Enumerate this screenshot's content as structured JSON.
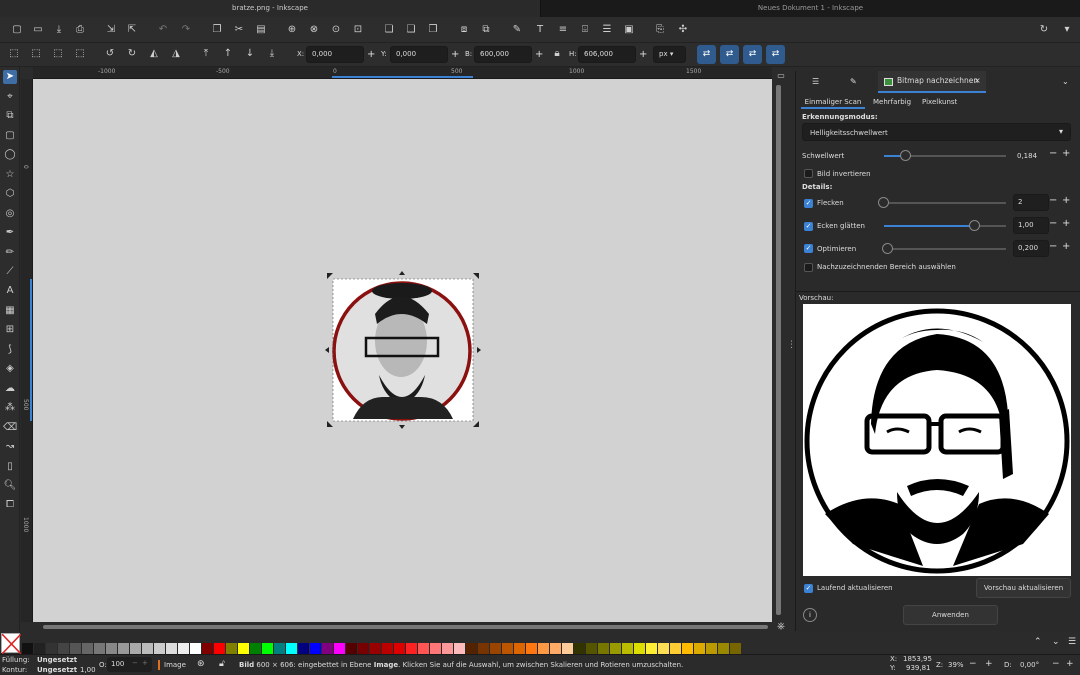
{
  "window": {
    "title_active": "bratze.png - Inkscape",
    "title_inactive": "Neues Dokument 1 - Inkscape"
  },
  "toolbar": {
    "x_label": "X:",
    "x_value": "0,000",
    "y_label": "Y:",
    "y_value": "0,000",
    "w_label": "B:",
    "w_value": "600,000",
    "h_label": "H:",
    "h_value": "606,000",
    "unit": "px"
  },
  "ruler": {
    "h_labels": [
      "-1000",
      "-500",
      "0",
      "500",
      "1000",
      "1500"
    ],
    "v_labels": [
      "0",
      "500",
      "1000"
    ]
  },
  "dock": {
    "tab_active": "Bitmap nachzeichnen",
    "subtabs": [
      "Einmaliger Scan",
      "Mehrfarbig",
      "Pixelkunst"
    ],
    "detection_label": "Erkennungsmodus:",
    "detection_mode": "Helligkeitsschwellwert",
    "threshold_label": "Schwellwert",
    "threshold_value": "0,184",
    "threshold_fraction": 0.18,
    "invert_label": "Bild invertieren",
    "invert_checked": false,
    "details_label": "Details:",
    "speckles_label": "Flecken",
    "speckles_value": "2",
    "speckles_checked": true,
    "smooth_label": "Ecken glätten",
    "smooth_value": "1,00",
    "smooth_checked": true,
    "optimize_label": "Optimieren",
    "optimize_value": "0,200",
    "optimize_checked": true,
    "area_label": "Nachzuzeichnenden Bereich auswählen",
    "area_checked": false,
    "preview_label": "Vorschau:",
    "live_update_label": "Laufend aktualisieren",
    "live_update_checked": true,
    "update_preview_button": "Vorschau aktualisieren",
    "apply_button": "Anwenden"
  },
  "status": {
    "fill_label": "Füllung:",
    "fill_value": "Ungesetzt",
    "stroke_label": "Kontur:",
    "stroke_value": "Ungesetzt",
    "stroke_width": "1,00",
    "opacity_label": "O:",
    "opacity_value": "100",
    "layer": "Image",
    "message_bold": "Bild",
    "message_1": "600 × 606: eingebettet in Ebene",
    "message_layer": "Image",
    "message_2": ". Klicken Sie auf die Auswahl, um zwischen Skalieren und Rotieren umzuschalten.",
    "x_label": "X:",
    "x_value": "1853,95",
    "y_label": "Y:",
    "y_value": "939,81",
    "zoom_label": "Z:",
    "zoom_value": "39%",
    "rot_label": "D:",
    "rot_value": "0,00°"
  },
  "colors": {
    "accent": "#3b82d4",
    "canvas": "#d2d2d2",
    "ring": "#8b1010"
  },
  "palette": [
    "#111111",
    "#222222",
    "#333333",
    "#444444",
    "#555555",
    "#666666",
    "#777777",
    "#888888",
    "#999999",
    "#aaaaaa",
    "#bbbbbb",
    "#cccccc",
    "#dddddd",
    "#eeeeee",
    "#ffffff",
    "#800000",
    "#ff0000",
    "#808000",
    "#ffff00",
    "#008000",
    "#00ff00",
    "#008080",
    "#00ffff",
    "#000080",
    "#0000ff",
    "#800080",
    "#ff00ff",
    "#550000",
    "#770000",
    "#990000",
    "#bb0000",
    "#dd0000",
    "#ff2222",
    "#ff5555",
    "#ff7777",
    "#ff9999",
    "#ffbbbb",
    "#552200",
    "#773300",
    "#994400",
    "#bb5500",
    "#dd6600",
    "#ff7711",
    "#ff9944",
    "#ffaa66",
    "#ffcc99",
    "#333300",
    "#555500",
    "#777700",
    "#999900",
    "#bbbb00",
    "#dddd00",
    "#ffee33",
    "#ffdd55",
    "#ffcc33",
    "#ffbb00",
    "#ddaa00",
    "#bb9900",
    "#998800",
    "#776600"
  ]
}
